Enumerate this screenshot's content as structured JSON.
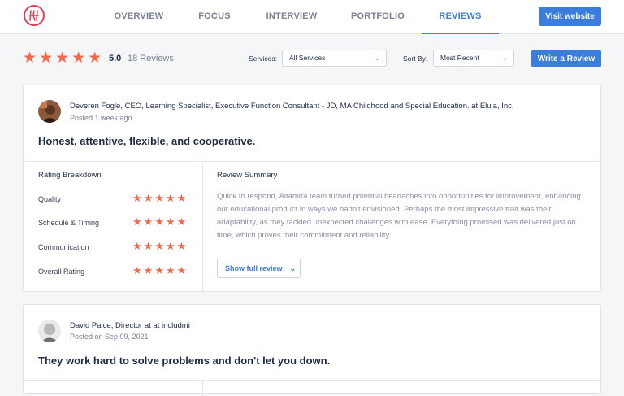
{
  "nav": {
    "tabs": [
      {
        "label": "OVERVIEW"
      },
      {
        "label": "FOCUS"
      },
      {
        "label": "INTERVIEW"
      },
      {
        "label": "PORTFOLIO"
      },
      {
        "label": "REVIEWS",
        "active": true
      }
    ],
    "visit_website": "Visit website"
  },
  "summary": {
    "rating": "5.0",
    "reviews_count": "18 Reviews",
    "services_label": "Services:",
    "services_value": "All Services",
    "sortby_label": "Sort By:",
    "sortby_value": "Most Recent",
    "write_review": "Write a Review"
  },
  "reviews": [
    {
      "reviewer": "Deveren Fogle, CEO, Learning Specialist, Executive Function Consultant - JD, MA Childhood and Special Education. at Elula, Inc.",
      "posted": "Posted 1 week ago",
      "headline": "Honest, attentive, flexible, and cooperative.",
      "breakdown_title": "Rating Breakdown",
      "breakdown": [
        {
          "label": "Quality",
          "stars": 5
        },
        {
          "label": "Schedule & Timing",
          "stars": 5
        },
        {
          "label": "Communication",
          "stars": 5
        },
        {
          "label": "Overall Rating",
          "stars": 5
        }
      ],
      "summary_title": "Review Summary",
      "summary": "Quick to respond, Altamira team turned potential headaches into opportunities for improvement, enhancing our educational product in ways we hadn't envisioned. Perhaps the most impressive trait was their adaptability, as they tackled unexpected challenges with ease. Everything promised was delivered just on time, which proves their commitment and reliability.",
      "show_full": "Show full review"
    },
    {
      "reviewer": "David Paice, Director at at includmi",
      "posted": "Posted on Sep 09, 2021",
      "headline": "They work hard to solve problems and don't let you down."
    }
  ],
  "colors": {
    "accent": "#3b7ddd",
    "star": "#f26a4b",
    "logo": "#e2405a"
  }
}
